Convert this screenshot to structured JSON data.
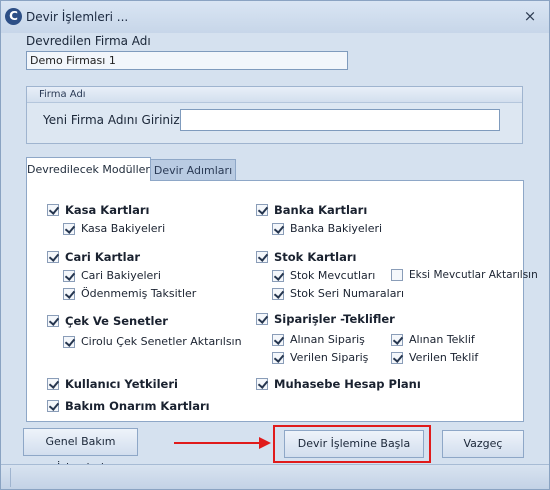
{
  "window": {
    "title": "Devir İşlemleri ...",
    "close_symbol": "×"
  },
  "form": {
    "transferred_firm_label": "Devredilen Firma Adı",
    "transferred_firm_value": "Demo Firması 1",
    "firm_group_title": "Firma Adı",
    "new_firm_label": "Yeni Firma Adını Giriniz",
    "new_firm_value": ""
  },
  "tabs": [
    {
      "label": "Devredilecek Modüller",
      "active": true
    },
    {
      "label": "Devir Adımları",
      "active": false
    }
  ],
  "modules": {
    "kasa": {
      "label": "Kasa Kartları",
      "checked": true,
      "sub": [
        {
          "label": "Kasa Bakiyeleri",
          "checked": true
        }
      ]
    },
    "banka": {
      "label": "Banka Kartları",
      "checked": true,
      "sub": [
        {
          "label": "Banka Bakiyeleri",
          "checked": true
        }
      ]
    },
    "cari": {
      "label": "Cari Kartlar",
      "checked": true,
      "sub": [
        {
          "label": "Cari Bakiyeleri",
          "checked": true
        },
        {
          "label": "Ödenmemiş Taksitler",
          "checked": true
        }
      ]
    },
    "stok": {
      "label": "Stok Kartları",
      "checked": true,
      "sub": [
        {
          "label": "Stok Mevcutları",
          "checked": true
        },
        {
          "label": "Eksi Mevcutlar Aktarılsın",
          "checked": false
        },
        {
          "label": "Stok Seri Numaraları",
          "checked": true
        }
      ]
    },
    "cek": {
      "label": "Çek Ve Senetler",
      "checked": true,
      "sub": [
        {
          "label": "Cirolu Çek Senetler Aktarılsın",
          "checked": true
        }
      ]
    },
    "siparis": {
      "label": "Siparişler -Teklifler",
      "checked": true,
      "sub": [
        {
          "label": "Alınan Sipariş",
          "checked": true
        },
        {
          "label": "Alınan Teklif",
          "checked": true
        },
        {
          "label": "Verilen Sipariş",
          "checked": true
        },
        {
          "label": "Verilen Teklif",
          "checked": true
        }
      ]
    },
    "kullanici": {
      "label": "Kullanıcı Yetkileri",
      "checked": true
    },
    "muhasebe": {
      "label": "Muhasebe Hesap Planı",
      "checked": true
    },
    "bakim": {
      "label": "Bakım Onarım Kartları",
      "checked": true
    }
  },
  "buttons": {
    "general_maintenance": "Genel Bakım İşlemleri",
    "start_transfer": "Devir İşlemine Başla",
    "cancel": "Vazgeç"
  },
  "colors": {
    "highlight": "#e01b1b",
    "window_bg": "#d5e1ef"
  }
}
